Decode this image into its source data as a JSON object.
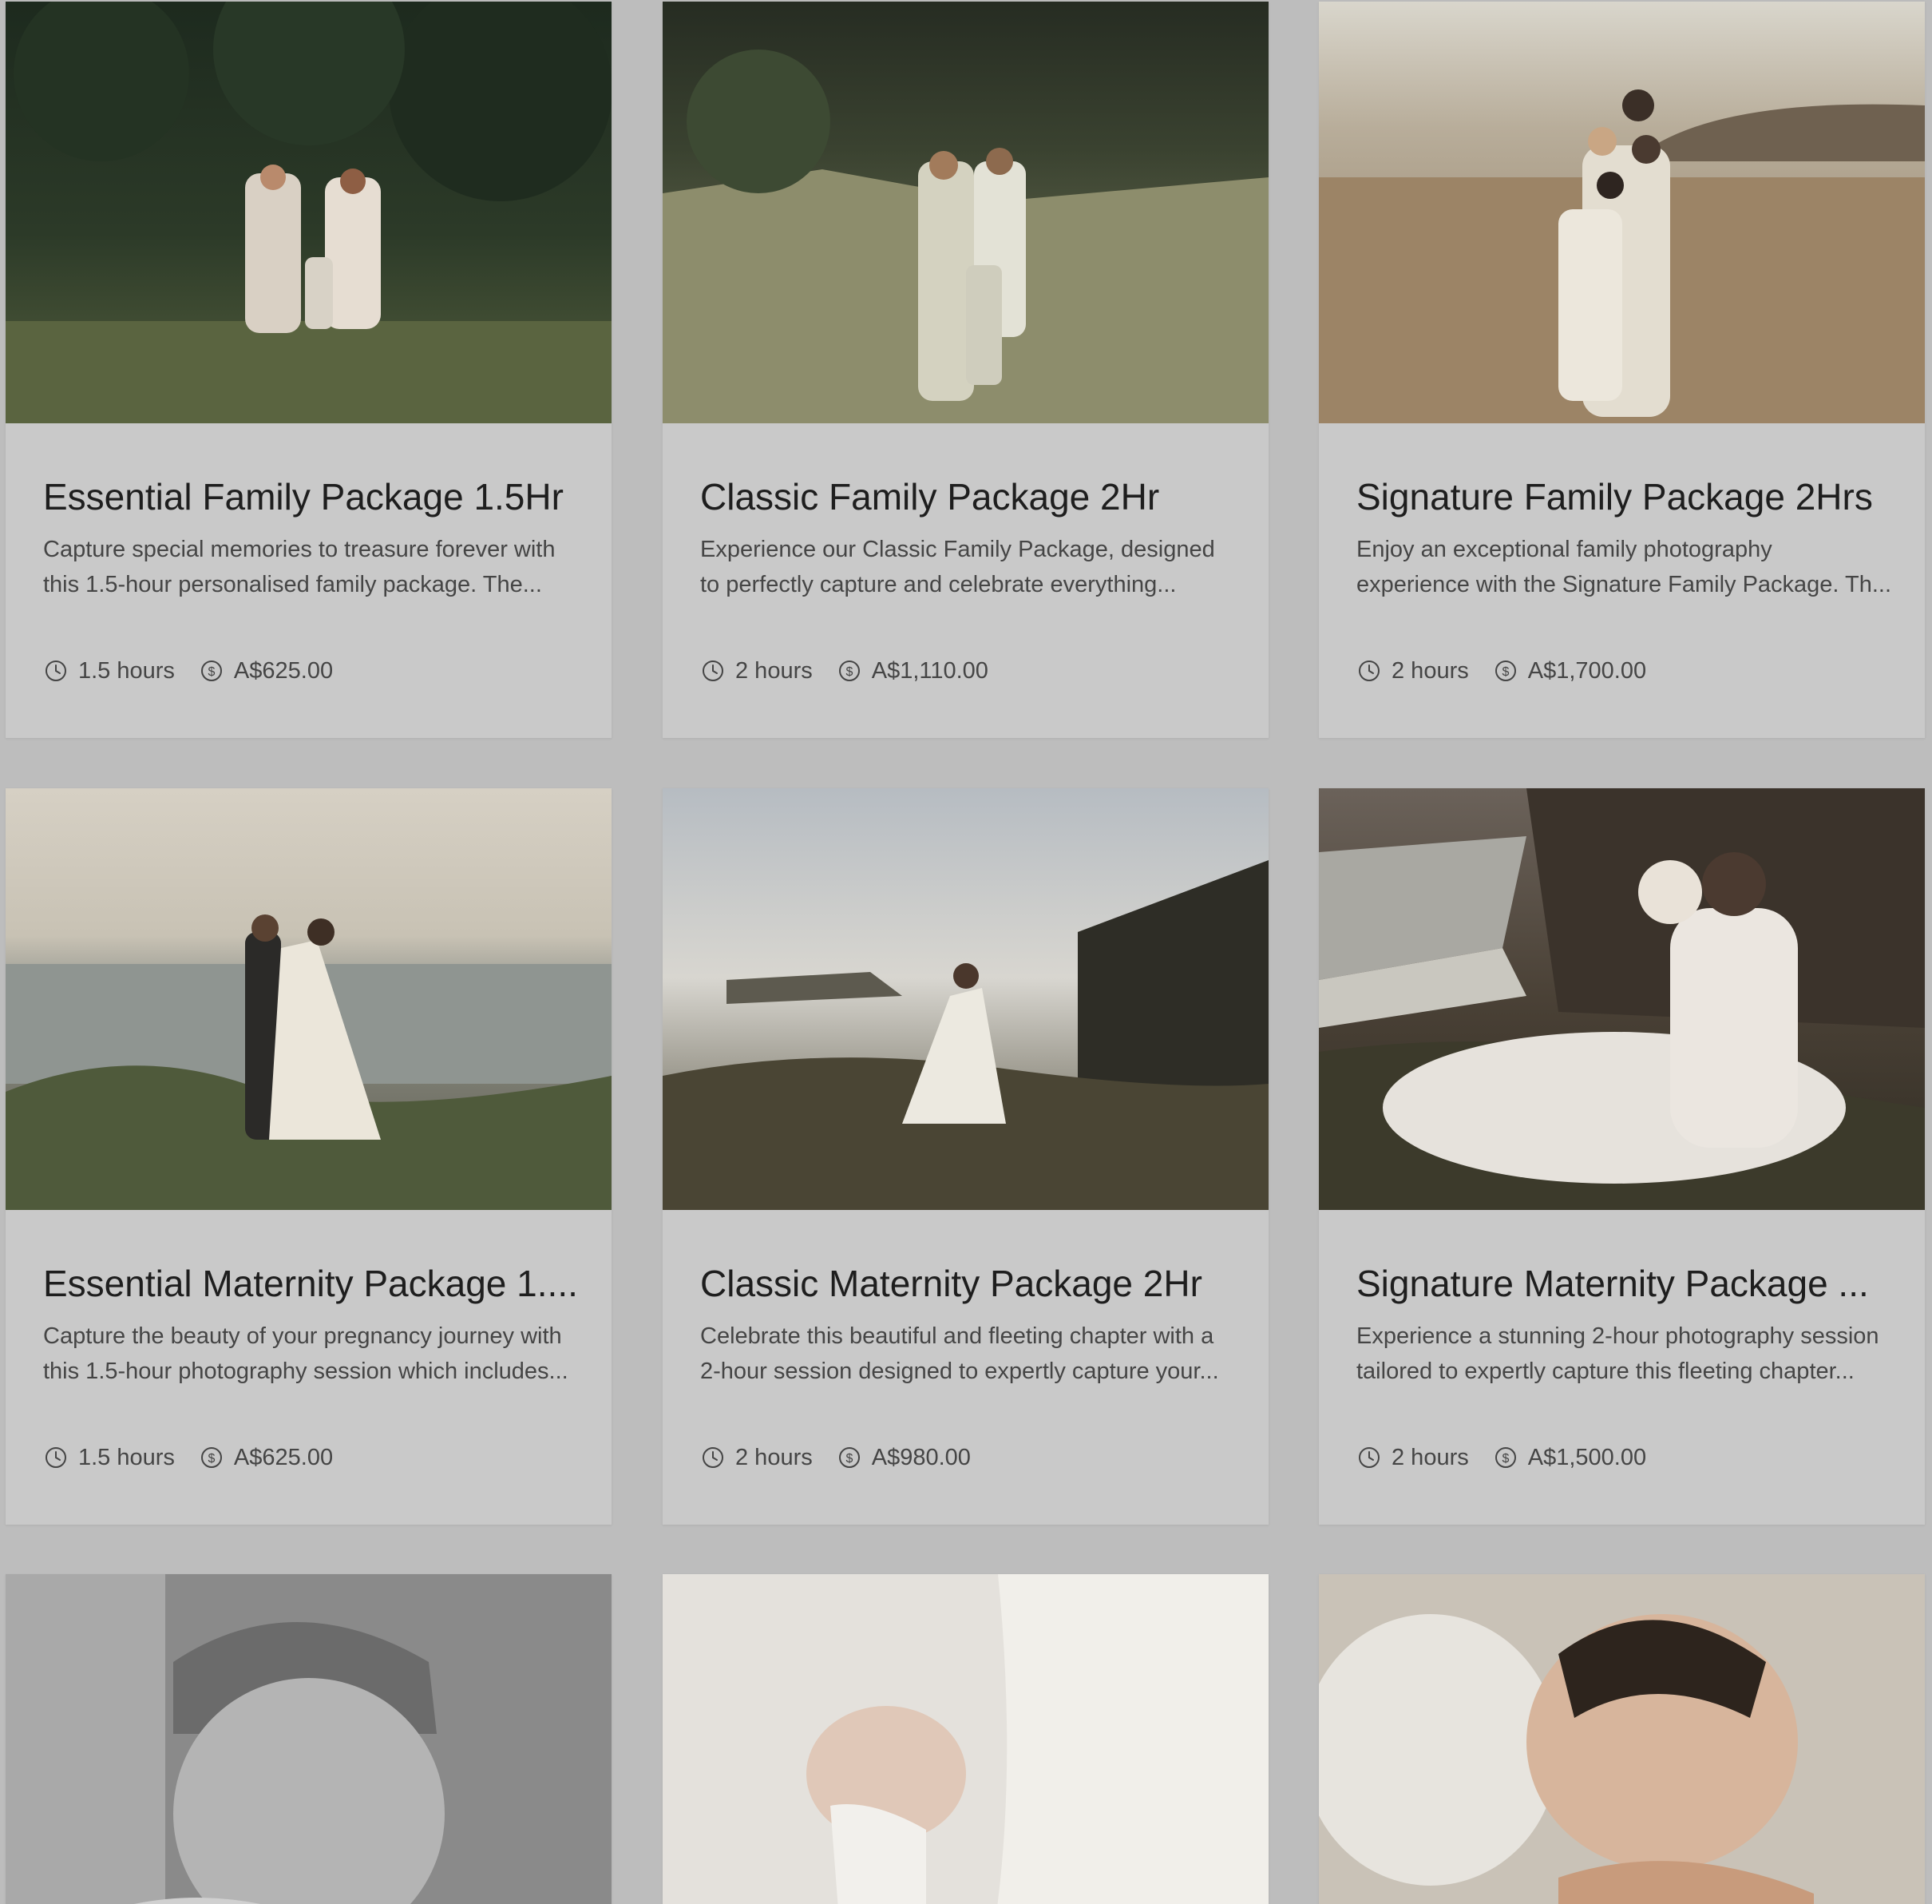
{
  "packages": [
    {
      "title": "Essential Family Package 1.5Hr",
      "description": "Capture special memories to treasure forever with\nthis 1.5-hour personalised family package. The...",
      "duration": "1.5 hours",
      "price": "A$625.00",
      "duration_icon": "clock-icon",
      "price_icon": "dollar-circle-icon"
    },
    {
      "title": "Classic Family Package 2Hr",
      "description": "Experience our Classic Family Package, designed\nto perfectly capture and celebrate everything...",
      "duration": "2 hours",
      "price": "A$1,110.00",
      "duration_icon": "clock-icon",
      "price_icon": "dollar-circle-icon"
    },
    {
      "title": "Signature Family Package 2Hrs",
      "description": "Enjoy an exceptional family photography\nexperience with the Signature Family Package. Th...",
      "duration": "2 hours",
      "price": "A$1,700.00",
      "duration_icon": "clock-icon",
      "price_icon": "dollar-circle-icon"
    },
    {
      "title": "Essential Maternity Package 1....",
      "description": "Capture the beauty of your pregnancy journey with\nthis 1.5-hour photography session which includes...",
      "duration": "1.5 hours",
      "price": "A$625.00",
      "duration_icon": "clock-icon",
      "price_icon": "dollar-circle-icon"
    },
    {
      "title": "Classic Maternity Package 2Hr",
      "description": "Celebrate this beautiful and fleeting chapter with a\n2-hour session designed to expertly capture your...",
      "duration": "2 hours",
      "price": "A$980.00",
      "duration_icon": "clock-icon",
      "price_icon": "dollar-circle-icon"
    },
    {
      "title": "Signature Maternity Package ...",
      "description": "Experience a stunning 2-hour photography session\ntailored to expertly capture this fleeting chapter...",
      "duration": "2 hours",
      "price": "A$1,500.00",
      "duration_icon": "clock-icon",
      "price_icon": "dollar-circle-icon"
    },
    {
      "title": "",
      "description": "",
      "duration": "",
      "price": ""
    },
    {
      "title": "",
      "description": "",
      "duration": "",
      "price": ""
    },
    {
      "title": "",
      "description": "",
      "duration": "",
      "price": ""
    }
  ],
  "colors": {
    "page_background": "#bdbdbd",
    "card_background": "#c9c9c9",
    "title_text": "#1e1e1e",
    "body_text": "#454545"
  }
}
